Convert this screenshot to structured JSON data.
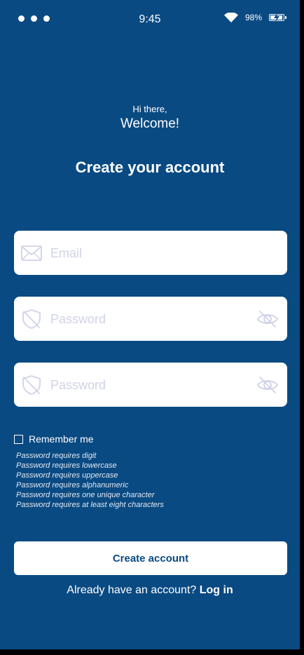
{
  "status_bar": {
    "time": "9:45",
    "battery": "98%"
  },
  "header": {
    "greeting": "Hi there,",
    "welcome": "Welcome!",
    "title": "Create your account"
  },
  "form": {
    "email_placeholder": "Email",
    "password_placeholder": "Password",
    "confirm_placeholder": "Password",
    "remember_label": "Remember me",
    "rules": [
      "Password requires digit",
      "Password requires lowercase",
      "Password requires uppercase",
      "Password requires alphanumeric",
      "Password requires one unique character",
      "Password requires at least eight characters"
    ],
    "submit_label": "Create account"
  },
  "footer": {
    "prompt": "Already have an account?",
    "login_label": "Log in"
  },
  "colors": {
    "background": "#0a4a82",
    "field_icon": "#d0d3e8"
  },
  "icons": {
    "email": "envelope-icon",
    "password": "shield-slash-icon",
    "toggle": "eye-slash-icon"
  }
}
